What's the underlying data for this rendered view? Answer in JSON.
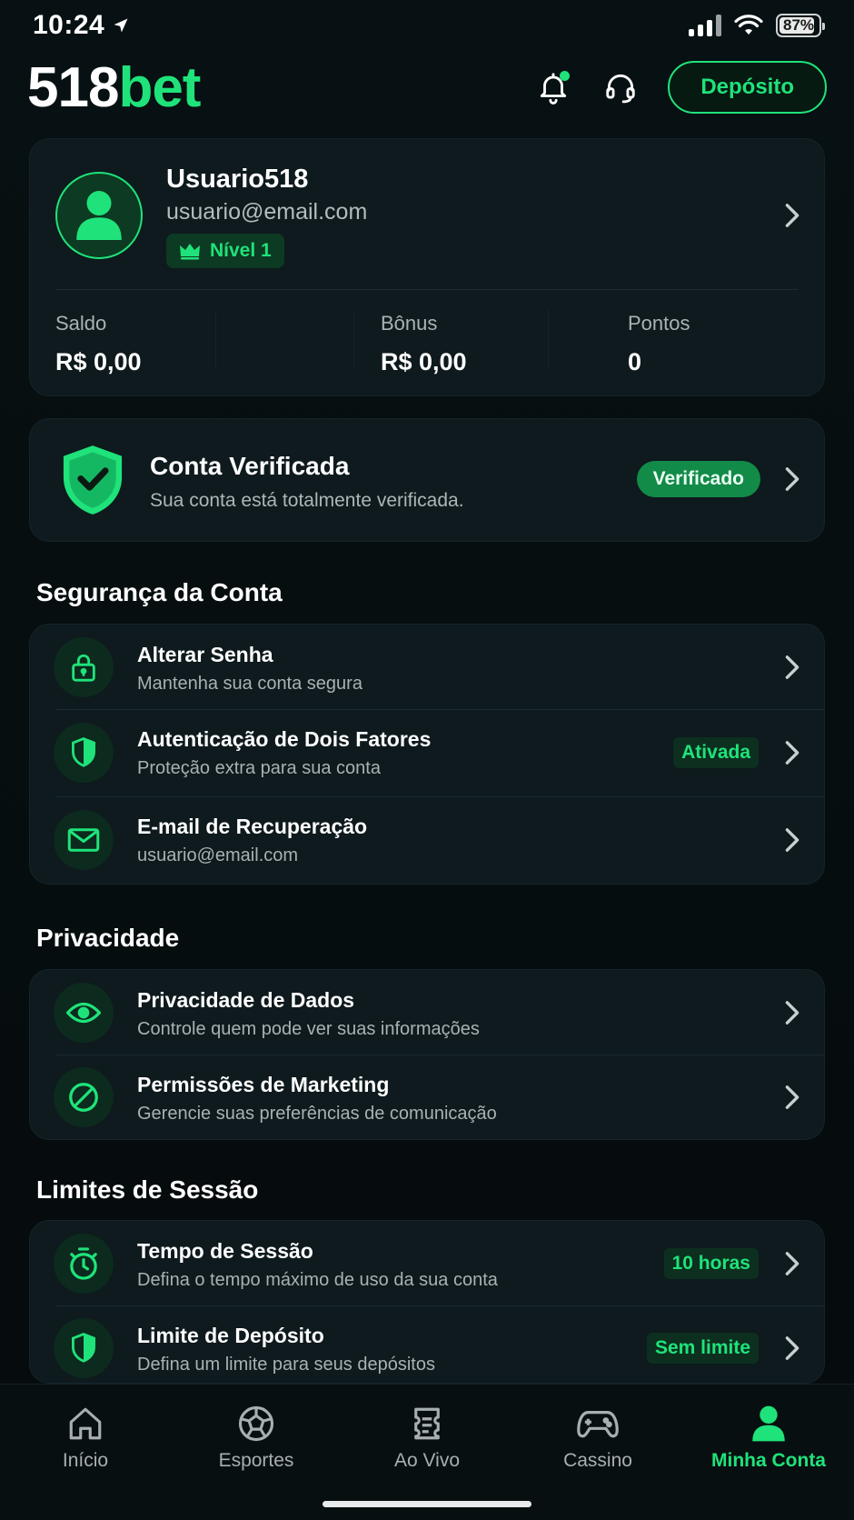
{
  "status_bar": {
    "time": "10:24",
    "battery": "87%"
  },
  "header": {
    "logo_num": "518",
    "logo_bet": "bet",
    "deposit_label": "Depósito"
  },
  "profile": {
    "name": "Usuario518",
    "email": "usuario@email.com",
    "level": "Nível 1",
    "stats": [
      {
        "label": "Saldo",
        "value": "R$ 0,00"
      },
      {
        "label": "Bônus",
        "value": "R$ 0,00"
      },
      {
        "label": "Pontos",
        "value": "0"
      }
    ]
  },
  "verified": {
    "title": "Conta Verificada",
    "subtitle": "Sua conta está totalmente verificada.",
    "badge": "Verificado"
  },
  "sections": {
    "security": {
      "title": "Segurança da Conta",
      "items": [
        {
          "title": "Alterar Senha",
          "subtitle": "Mantenha sua conta segura",
          "icon": "lock-icon"
        },
        {
          "title": "Autenticação de Dois Fatores",
          "subtitle": "Proteção extra para sua conta",
          "badge": "Ativada",
          "icon": "shield-icon"
        },
        {
          "title": "E-mail de Recuperação",
          "subtitle": "usuario@email.com",
          "icon": "mail-icon"
        }
      ]
    },
    "privacy": {
      "title": "Privacidade",
      "items": [
        {
          "title": "Privacidade de Dados",
          "subtitle": "Controle quem pode ver suas informações",
          "icon": "eye-icon"
        },
        {
          "title": "Permissões de Marketing",
          "subtitle": "Gerencie suas preferências de comunicação",
          "icon": "block-icon"
        }
      ]
    },
    "limits": {
      "title": "Limites de Sessão",
      "items": [
        {
          "title": "Tempo de Sessão",
          "subtitle": "Defina o tempo máximo de uso da sua conta",
          "badge": "10 horas",
          "icon": "stopwatch-icon"
        },
        {
          "title": "Limite de Depósito",
          "subtitle": "Defina um limite para seus depósitos",
          "badge": "Sem limite",
          "icon": "shield-icon"
        }
      ]
    }
  },
  "nav": [
    {
      "label": "Início",
      "icon": "home-icon"
    },
    {
      "label": "Esportes",
      "icon": "ball-icon"
    },
    {
      "label": "Ao Vivo",
      "icon": "ticket-icon"
    },
    {
      "label": "Cassino",
      "icon": "gamepad-icon"
    },
    {
      "label": "Minha Conta",
      "icon": "user-icon",
      "active": true
    }
  ],
  "colors": {
    "accent": "#1fe37a",
    "background": "#060b0d",
    "card": "#0e1a1d"
  }
}
